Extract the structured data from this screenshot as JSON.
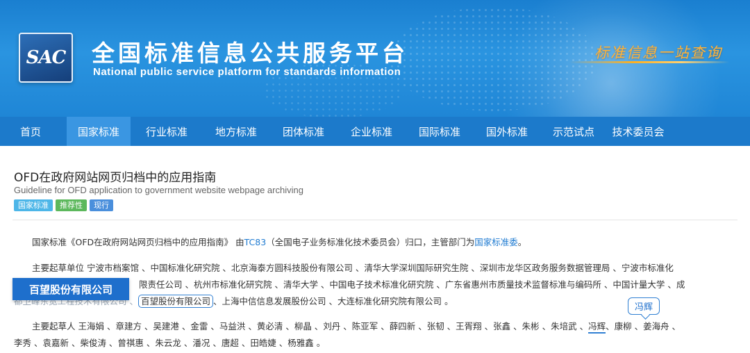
{
  "header": {
    "logo_text": "SAC",
    "title_cn": "全国标准信息公共服务平台",
    "title_en": "National public service platform  for standards information",
    "slogan": "标准信息一站查询"
  },
  "nav": {
    "items": [
      {
        "label": "首页"
      },
      {
        "label": "国家标准"
      },
      {
        "label": "行业标准"
      },
      {
        "label": "地方标准"
      },
      {
        "label": "团体标准"
      },
      {
        "label": "企业标准"
      },
      {
        "label": "国际标准"
      },
      {
        "label": "国外标准"
      },
      {
        "label": "示范试点"
      },
      {
        "label": "技术委员会"
      }
    ],
    "active_index": 1
  },
  "standard": {
    "title_cn": "OFD在政府网站网页归档中的应用指南",
    "title_en": "Guideline for OFD application to government website webpage archiving",
    "badges": [
      {
        "label": "国家标准",
        "color": "#4db6e8"
      },
      {
        "label": "推荐性",
        "color": "#5cb85c"
      },
      {
        "label": "现行",
        "color": "#4a8fdc"
      }
    ]
  },
  "intro": {
    "prefix": "国家标准《OFD在政府网站网页归档中的应用指南》 由",
    "tc_link": "TC83",
    "middle": "（全国电子业务标准化技术委员会）归口，主管部门为",
    "dept_link": "国家标准委",
    "suffix": "。"
  },
  "drafting_units": {
    "line1": "主要起草单位 宁波市档案馆 、中国标准化研究院 、北京海泰方圆科技股份有限公司 、清华大学深圳国际研究生院 、深圳市龙华区政务服务数据管理局 、宁波市标准化",
    "line2_visible": "限责任公司 、杭州市标准化研究院 、清华大学 、中国电子技术标准化研究院 、广东省惠州市质量技术监督标准与编码所 、中国计量大学 、成",
    "line3_prefix": "都卫峰东宽工程技术有限公司 、",
    "line3_highlight": "百望股份有限公司",
    "line3_suffix": "、上海中信信息发展股份公司 、大连标准化研究院有限公司 。"
  },
  "drafters": {
    "line1_prefix": "主要起草人 王海娟 、章建方 、吴建港 、金雷 、马益洪 、黄必清 、柳晶 、刘丹 、陈亚军 、薛四新 、张韧 、王胥翔 、张鑫 、朱彬 、朱培武 、",
    "line1_highlight": "冯辉",
    "line1_suffix": "、康柳 、姜海舟 、",
    "line2": "李秀 、袁嘉新 、柴俊涛 、曾祺惠 、朱云龙 、潘况 、唐超 、田皓婕 、杨雅鑫 。"
  },
  "callouts": {
    "company": "百望股份有限公司",
    "person": "冯辉"
  }
}
